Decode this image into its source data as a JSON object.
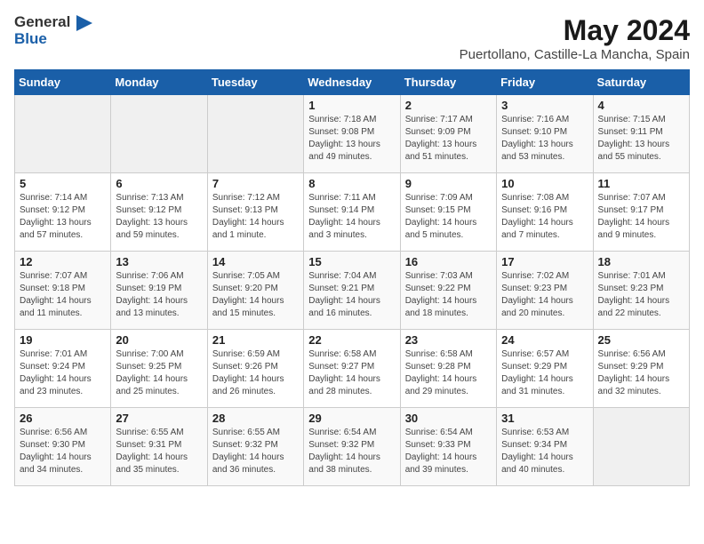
{
  "header": {
    "logo_general": "General",
    "logo_blue": "Blue",
    "month_year": "May 2024",
    "location": "Puertollano, Castille-La Mancha, Spain"
  },
  "weekdays": [
    "Sunday",
    "Monday",
    "Tuesday",
    "Wednesday",
    "Thursday",
    "Friday",
    "Saturday"
  ],
  "weeks": [
    [
      {
        "day": "",
        "info": ""
      },
      {
        "day": "",
        "info": ""
      },
      {
        "day": "",
        "info": ""
      },
      {
        "day": "1",
        "info": "Sunrise: 7:18 AM\nSunset: 9:08 PM\nDaylight: 13 hours\nand 49 minutes."
      },
      {
        "day": "2",
        "info": "Sunrise: 7:17 AM\nSunset: 9:09 PM\nDaylight: 13 hours\nand 51 minutes."
      },
      {
        "day": "3",
        "info": "Sunrise: 7:16 AM\nSunset: 9:10 PM\nDaylight: 13 hours\nand 53 minutes."
      },
      {
        "day": "4",
        "info": "Sunrise: 7:15 AM\nSunset: 9:11 PM\nDaylight: 13 hours\nand 55 minutes."
      }
    ],
    [
      {
        "day": "5",
        "info": "Sunrise: 7:14 AM\nSunset: 9:12 PM\nDaylight: 13 hours\nand 57 minutes."
      },
      {
        "day": "6",
        "info": "Sunrise: 7:13 AM\nSunset: 9:12 PM\nDaylight: 13 hours\nand 59 minutes."
      },
      {
        "day": "7",
        "info": "Sunrise: 7:12 AM\nSunset: 9:13 PM\nDaylight: 14 hours\nand 1 minute."
      },
      {
        "day": "8",
        "info": "Sunrise: 7:11 AM\nSunset: 9:14 PM\nDaylight: 14 hours\nand 3 minutes."
      },
      {
        "day": "9",
        "info": "Sunrise: 7:09 AM\nSunset: 9:15 PM\nDaylight: 14 hours\nand 5 minutes."
      },
      {
        "day": "10",
        "info": "Sunrise: 7:08 AM\nSunset: 9:16 PM\nDaylight: 14 hours\nand 7 minutes."
      },
      {
        "day": "11",
        "info": "Sunrise: 7:07 AM\nSunset: 9:17 PM\nDaylight: 14 hours\nand 9 minutes."
      }
    ],
    [
      {
        "day": "12",
        "info": "Sunrise: 7:07 AM\nSunset: 9:18 PM\nDaylight: 14 hours\nand 11 minutes."
      },
      {
        "day": "13",
        "info": "Sunrise: 7:06 AM\nSunset: 9:19 PM\nDaylight: 14 hours\nand 13 minutes."
      },
      {
        "day": "14",
        "info": "Sunrise: 7:05 AM\nSunset: 9:20 PM\nDaylight: 14 hours\nand 15 minutes."
      },
      {
        "day": "15",
        "info": "Sunrise: 7:04 AM\nSunset: 9:21 PM\nDaylight: 14 hours\nand 16 minutes."
      },
      {
        "day": "16",
        "info": "Sunrise: 7:03 AM\nSunset: 9:22 PM\nDaylight: 14 hours\nand 18 minutes."
      },
      {
        "day": "17",
        "info": "Sunrise: 7:02 AM\nSunset: 9:23 PM\nDaylight: 14 hours\nand 20 minutes."
      },
      {
        "day": "18",
        "info": "Sunrise: 7:01 AM\nSunset: 9:23 PM\nDaylight: 14 hours\nand 22 minutes."
      }
    ],
    [
      {
        "day": "19",
        "info": "Sunrise: 7:01 AM\nSunset: 9:24 PM\nDaylight: 14 hours\nand 23 minutes."
      },
      {
        "day": "20",
        "info": "Sunrise: 7:00 AM\nSunset: 9:25 PM\nDaylight: 14 hours\nand 25 minutes."
      },
      {
        "day": "21",
        "info": "Sunrise: 6:59 AM\nSunset: 9:26 PM\nDaylight: 14 hours\nand 26 minutes."
      },
      {
        "day": "22",
        "info": "Sunrise: 6:58 AM\nSunset: 9:27 PM\nDaylight: 14 hours\nand 28 minutes."
      },
      {
        "day": "23",
        "info": "Sunrise: 6:58 AM\nSunset: 9:28 PM\nDaylight: 14 hours\nand 29 minutes."
      },
      {
        "day": "24",
        "info": "Sunrise: 6:57 AM\nSunset: 9:29 PM\nDaylight: 14 hours\nand 31 minutes."
      },
      {
        "day": "25",
        "info": "Sunrise: 6:56 AM\nSunset: 9:29 PM\nDaylight: 14 hours\nand 32 minutes."
      }
    ],
    [
      {
        "day": "26",
        "info": "Sunrise: 6:56 AM\nSunset: 9:30 PM\nDaylight: 14 hours\nand 34 minutes."
      },
      {
        "day": "27",
        "info": "Sunrise: 6:55 AM\nSunset: 9:31 PM\nDaylight: 14 hours\nand 35 minutes."
      },
      {
        "day": "28",
        "info": "Sunrise: 6:55 AM\nSunset: 9:32 PM\nDaylight: 14 hours\nand 36 minutes."
      },
      {
        "day": "29",
        "info": "Sunrise: 6:54 AM\nSunset: 9:32 PM\nDaylight: 14 hours\nand 38 minutes."
      },
      {
        "day": "30",
        "info": "Sunrise: 6:54 AM\nSunset: 9:33 PM\nDaylight: 14 hours\nand 39 minutes."
      },
      {
        "day": "31",
        "info": "Sunrise: 6:53 AM\nSunset: 9:34 PM\nDaylight: 14 hours\nand 40 minutes."
      },
      {
        "day": "",
        "info": ""
      }
    ]
  ]
}
